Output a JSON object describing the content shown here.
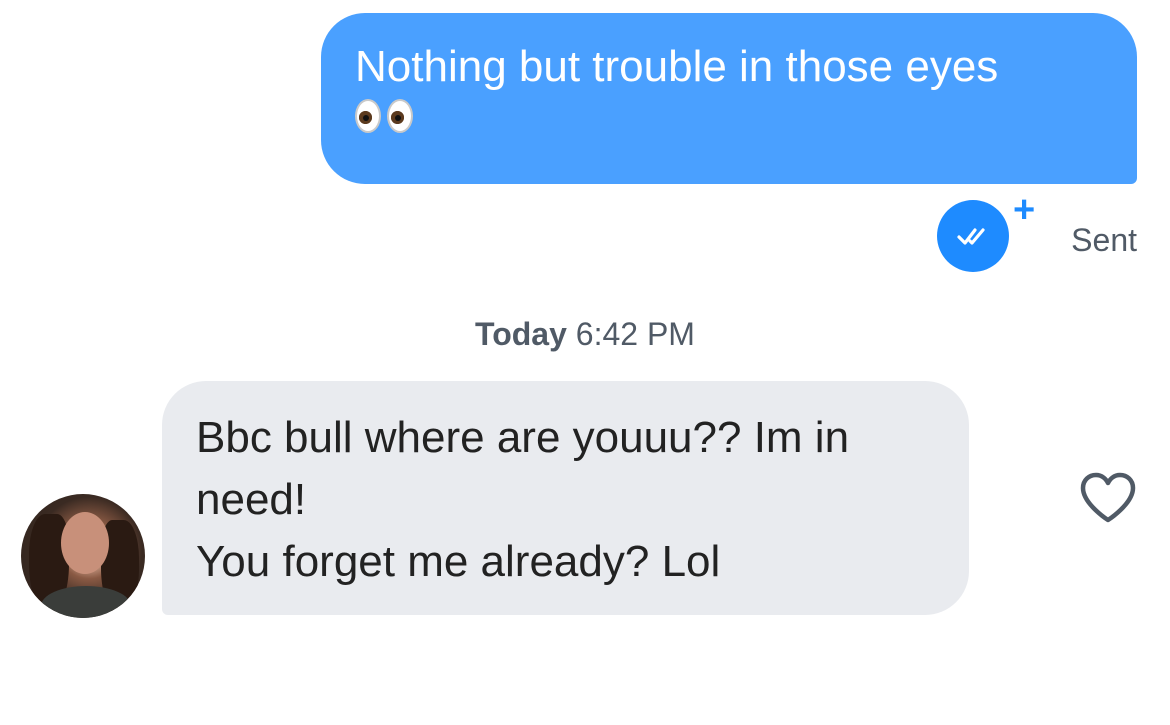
{
  "outgoing_message": {
    "text": "Nothing but trouble in those eyes",
    "emoji": "👀",
    "emoji_name": "eyes"
  },
  "delivery_status": {
    "read_icon": "double-check-icon",
    "plus_symbol": "+",
    "label": "Sent"
  },
  "timestamp": {
    "day": "Today",
    "time": "6:42 PM"
  },
  "incoming_message": {
    "lines": [
      "Bbc bull where are youuu?? Im in",
      "need!",
      "You forget me already? Lol"
    ]
  },
  "like_button": {
    "icon": "heart-outline-icon"
  },
  "colors": {
    "outgoing_bubble": "#4aa0ff",
    "incoming_bubble": "#e9ebef",
    "accent_blue": "#1e8bff",
    "muted_text": "#505a66"
  }
}
